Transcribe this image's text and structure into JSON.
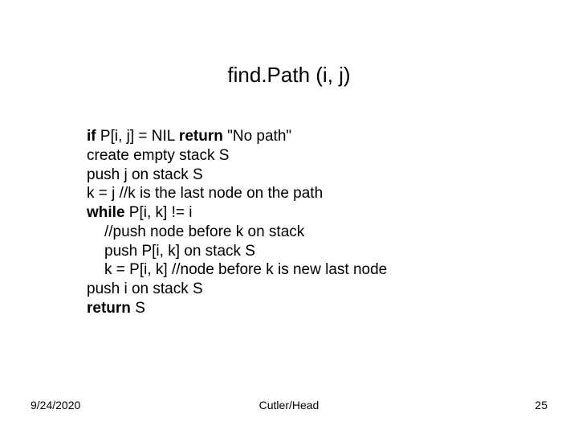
{
  "title": "find.Path (i, j)",
  "lines": [
    {
      "indent": 0,
      "segments": [
        {
          "b": true,
          "t": "if "
        },
        {
          "b": false,
          "t": "P[i, j] = NIL "
        },
        {
          "b": true,
          "t": "return "
        },
        {
          "b": false,
          "t": "\"No path\""
        }
      ]
    },
    {
      "indent": 0,
      "segments": [
        {
          "b": false,
          "t": "create empty stack S"
        }
      ]
    },
    {
      "indent": 0,
      "segments": [
        {
          "b": false,
          "t": "push j on stack S"
        }
      ]
    },
    {
      "indent": 0,
      "segments": [
        {
          "b": false,
          "t": "k = j //k is the last node on the path"
        }
      ]
    },
    {
      "indent": 0,
      "segments": [
        {
          "b": true,
          "t": "while "
        },
        {
          "b": false,
          "t": "P[i, k] != i"
        }
      ]
    },
    {
      "indent": 1,
      "segments": [
        {
          "b": false,
          "t": "//push node before k on stack"
        }
      ]
    },
    {
      "indent": 1,
      "segments": [
        {
          "b": false,
          "t": "push P[i, k] on stack S"
        }
      ]
    },
    {
      "indent": 1,
      "segments": [
        {
          "b": false,
          "t": "k = P[i, k] //node before k is new last node"
        }
      ]
    },
    {
      "indent": 0,
      "segments": [
        {
          "b": false,
          "t": "push i on stack S"
        }
      ]
    },
    {
      "indent": 0,
      "segments": [
        {
          "b": true,
          "t": "return "
        },
        {
          "b": false,
          "t": "S"
        }
      ]
    }
  ],
  "footer": {
    "date": "9/24/2020",
    "center": "Cutler/Head",
    "page": "25"
  }
}
